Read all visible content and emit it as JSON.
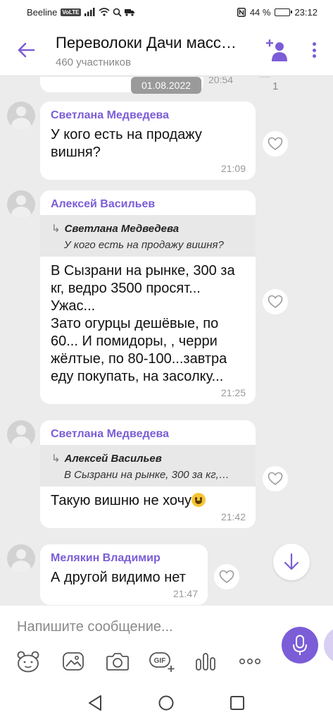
{
  "status_bar": {
    "carrier": "Beeline",
    "volte": "VoLTE",
    "battery": "44 %",
    "battery_level": 0.44,
    "time": "23:12"
  },
  "header": {
    "title": "Переволоки Дачи масс…",
    "subtitle": "460 участников",
    "back_icon": "arrow-left-icon",
    "add_member_icon": "add-person-icon",
    "menu_icon": "kebab-menu-icon",
    "accent_color": "#7b5dd7"
  },
  "chat": {
    "previous": {
      "time": "20:54",
      "count": "1"
    },
    "date_chip": "01.08.2022",
    "messages": [
      {
        "sender": "Светлана Медведева",
        "lines": [
          "У кого есть на продажу",
          "вишня?"
        ],
        "time": "21:09"
      },
      {
        "sender": "Алексей Васильев",
        "quote": {
          "author": "Светлана Медведева",
          "text": "У кого есть на продажу вишня?"
        },
        "lines": [
          "В Сызрани на рынке, 300 за",
          "кг, ведро 3500 просят...",
          "Ужас...",
          "Зато огурцы дешёвые, по",
          "60... И помидоры, , черри",
          "жёлтые, по 80-100...завтра",
          "еду покупать, на засолку..."
        ],
        "time": "21:25"
      },
      {
        "sender": "Светлана Медведева",
        "quote": {
          "author": "Алексей Васильев",
          "text": "В Сызрани на рынке, 300 за кг,…"
        },
        "lines": [
          "Такую вишню не хочу"
        ],
        "time": "21:42"
      },
      {
        "sender": "Мелякин Владимир",
        "lines": [
          "А другой видимо нет"
        ],
        "time": "21:47"
      }
    ]
  },
  "composer": {
    "placeholder": "Напишите сообщение..."
  },
  "toolbar": {
    "gif_label": "GIF"
  }
}
